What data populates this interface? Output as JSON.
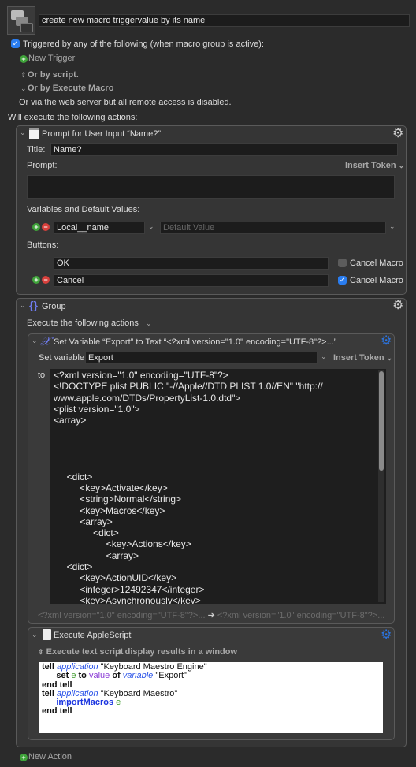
{
  "macro": {
    "name": "create new macro triggervalue by its name",
    "icon": "macro-stack-icon"
  },
  "triggers": {
    "enabled": true,
    "heading": "Triggered by any of the following (when macro group is active):",
    "new_trigger": "New Trigger",
    "or_by_script": "Or by script.",
    "or_by_execute_macro": "Or by Execute Macro",
    "web_server": "Or via the web server but all remote access is disabled."
  },
  "actions_heading": "Will execute the following actions:",
  "prompt_action": {
    "title": "Prompt for User Input “Name?”",
    "title_label": "Title:",
    "title_value": "Name?",
    "prompt_label": "Prompt:",
    "insert_token": "Insert Token",
    "prompt_value": "",
    "variables_label": "Variables and Default Values:",
    "variable_name": "Local__name",
    "default_placeholder": "Default Value",
    "buttons_label": "Buttons:",
    "buttons": [
      {
        "label": "OK",
        "cancel_macro": false,
        "cancel_label": "Cancel Macro"
      },
      {
        "label": "Cancel",
        "cancel_macro": true,
        "cancel_label": "Cancel Macro"
      }
    ]
  },
  "group": {
    "title": "Group",
    "mode": "Execute the following actions",
    "set_variable": {
      "title": "Set Variable “Export” to Text “<?xml version=\"1.0\" encoding=\"UTF-8\"?>...”",
      "set_label": "Set variable",
      "variable": "Export",
      "insert_token": "Insert Token",
      "to_label": "to",
      "text_lines": [
        "<?xml version=\"1.0\" encoding=\"UTF-8\"?>",
        "<!DOCTYPE plist PUBLIC \"-//Apple//DTD PLIST 1.0//EN\" \"http://",
        "www.apple.com/DTDs/PropertyList-1.0.dtd\">",
        "<plist version=\"1.0\">",
        "<array>",
        "",
        "",
        "",
        "",
        "     <dict>",
        "          <key>Activate</key>",
        "          <string>Normal</string>",
        "          <key>Macros</key>",
        "          <array>",
        "               <dict>",
        "                    <key>Actions</key>",
        "                    <array>",
        "     <dict>",
        "          <key>ActionUID</key>",
        "          <integer>12492347</integer>",
        "          <key>Asynchronously</key>"
      ],
      "footer_from": "<?xml version=\"1.0\" encoding=\"UTF-8\"?>...",
      "footer_arrow": "➔",
      "footer_to": "<?xml version=\"1.0\" encoding=\"UTF-8\"?>..."
    },
    "applescript": {
      "title": "Execute AppleScript",
      "option_source": "Execute text script",
      "option_results": "display results in a window",
      "script": {
        "l1_tell": "tell",
        "l1_app": "application",
        "l1_str": " \"Keyboard Maestro Engine\"",
        "l2_set": "set",
        "l2_e": "e",
        "l2_to": "to",
        "l2_value": "value",
        "l2_of": "of",
        "l2_variable": "variable",
        "l2_str": " \"Export\"",
        "l3": "end tell",
        "l4_tell": "tell",
        "l4_app": "application",
        "l4_str": " \"Keyboard Maestro\"",
        "l5_cmd": "importMacros",
        "l5_e": "e",
        "l6": "end tell"
      }
    }
  },
  "new_action": "New Action"
}
